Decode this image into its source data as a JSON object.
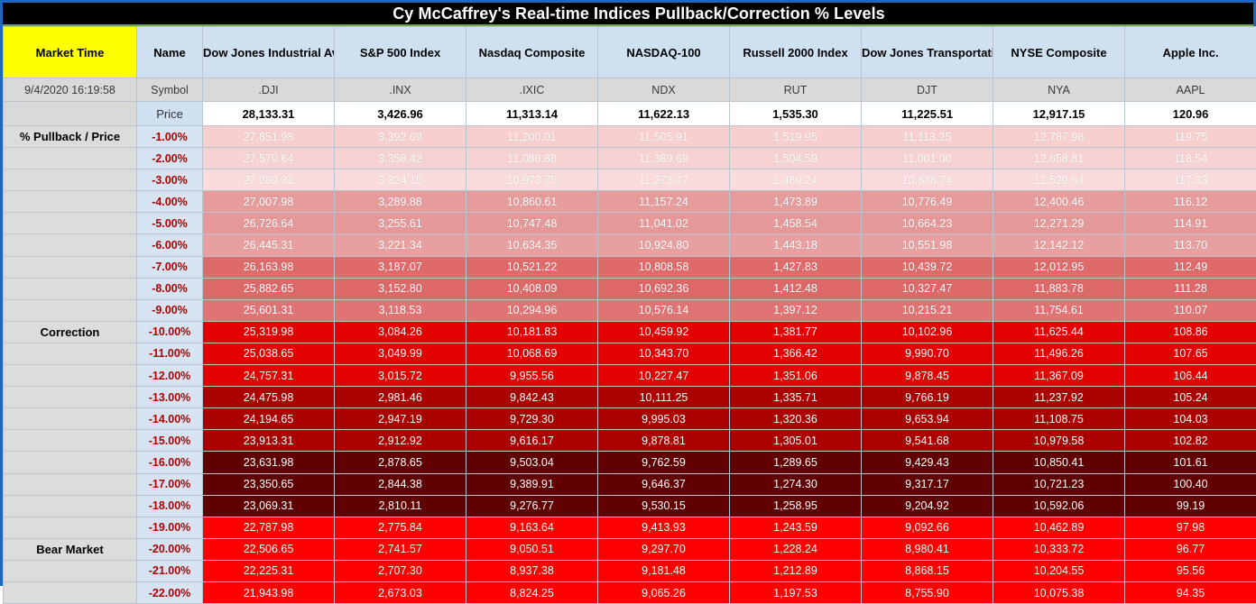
{
  "window": {
    "title": "Cy McCaffrey's Real-time Indices Pullback/Correction % Levels",
    "border_color": "#1f66c1",
    "title_bg": "#000000",
    "title_fg": "#ffffff",
    "accent_green": "#6ea64a"
  },
  "header": {
    "market_time_label": "Market Time",
    "name_label": "Name",
    "market_time_bg": "#ffff00",
    "header_bg": "#cfe0f0",
    "columns": [
      "Dow Jones Industrial Average",
      "S&P 500 Index",
      "Nasdaq Composite",
      "NASDAQ-100",
      "Russell 2000 Index",
      "Dow Jones Transportation Average",
      "NYSE Composite",
      "Apple Inc."
    ]
  },
  "symbol_row": {
    "timestamp": "9/4/2020 16:19:58",
    "row_label": "Symbol",
    "symbols": [
      ".DJI",
      ".INX",
      ".IXIC",
      "NDX",
      "RUT",
      "DJT",
      "NYA",
      "AAPL"
    ]
  },
  "price_row": {
    "row_label": "Price",
    "prices": [
      "28,133.31",
      "3,426.96",
      "11,313.14",
      "11,622.13",
      "1,535.30",
      "11,225.51",
      "12,917.15",
      "120.96"
    ]
  },
  "section_labels": {
    "pullback": "% Pullback / Price",
    "correction": "Correction",
    "bear_market": "Bear Market"
  },
  "rows": [
    {
      "label": "% Pullback / Price",
      "pct": "-1.00%",
      "band": "band1 b1a",
      "values": [
        "27,851.98",
        "3,392.69",
        "11,200.01",
        "11,505.91",
        "1,519.95",
        "11,113.25",
        "12,787.98",
        "119.75"
      ]
    },
    {
      "label": "",
      "pct": "-2.00%",
      "band": "band1 b1b",
      "values": [
        "27,570.64",
        "3,358.42",
        "11,086.88",
        "11,389.69",
        "1,504.59",
        "11,001.00",
        "12,658.81",
        "118.54"
      ]
    },
    {
      "label": "",
      "pct": "-3.00%",
      "band": "band1 b1c",
      "values": [
        "27,289.31",
        "3,324.15",
        "10,973.75",
        "11,273.47",
        "1,489.24",
        "10,888.74",
        "12,529.64",
        "117.33"
      ]
    },
    {
      "label": "",
      "pct": "-4.00%",
      "band": "band2 b2a",
      "values": [
        "27,007.98",
        "3,289.88",
        "10,860.61",
        "11,157.24",
        "1,473.89",
        "10,776.49",
        "12,400.46",
        "116.12"
      ]
    },
    {
      "label": "",
      "pct": "-5.00%",
      "band": "band2 b2b",
      "values": [
        "26,726.64",
        "3,255.61",
        "10,747.48",
        "11,041.02",
        "1,458.54",
        "10,664.23",
        "12,271.29",
        "114.91"
      ]
    },
    {
      "label": "",
      "pct": "-6.00%",
      "band": "band2 b2c",
      "values": [
        "26,445.31",
        "3,221.34",
        "10,634.35",
        "10,924.80",
        "1,443.18",
        "10,551.98",
        "12,142.12",
        "113.70"
      ]
    },
    {
      "label": "",
      "pct": "-7.00%",
      "band": "band3 b3a",
      "values": [
        "26,163.98",
        "3,187.07",
        "10,521.22",
        "10,808.58",
        "1,427.83",
        "10,439.72",
        "12,012.95",
        "112.49"
      ]
    },
    {
      "label": "",
      "pct": "-8.00%",
      "band": "band3 b3b",
      "values": [
        "25,882.65",
        "3,152.80",
        "10,408.09",
        "10,692.36",
        "1,412.48",
        "10,327.47",
        "11,883.78",
        "111.28"
      ]
    },
    {
      "label": "",
      "pct": "-9.00%",
      "band": "band3 b3c",
      "values": [
        "25,601.31",
        "3,118.53",
        "10,294.96",
        "10,576.14",
        "1,397.12",
        "10,215.21",
        "11,754.61",
        "110.07"
      ]
    },
    {
      "label": "Correction",
      "pct": "-10.00%",
      "band": "band4",
      "values": [
        "25,319.98",
        "3,084.26",
        "10,181.83",
        "10,459.92",
        "1,381.77",
        "10,102.96",
        "11,625.44",
        "108.86"
      ]
    },
    {
      "label": "",
      "pct": "-11.00%",
      "band": "band4",
      "values": [
        "25,038.65",
        "3,049.99",
        "10,068.69",
        "10,343.70",
        "1,366.42",
        "9,990.70",
        "11,496.26",
        "107.65"
      ]
    },
    {
      "label": "",
      "pct": "-12.00%",
      "band": "band4",
      "values": [
        "24,757.31",
        "3,015.72",
        "9,955.56",
        "10,227.47",
        "1,351.06",
        "9,878.45",
        "11,367.09",
        "106.44"
      ]
    },
    {
      "label": "",
      "pct": "-13.00%",
      "band": "band5",
      "values": [
        "24,475.98",
        "2,981.46",
        "9,842.43",
        "10,111.25",
        "1,335.71",
        "9,766.19",
        "11,237.92",
        "105.24"
      ]
    },
    {
      "label": "",
      "pct": "-14.00%",
      "band": "band5",
      "values": [
        "24,194.65",
        "2,947.19",
        "9,729.30",
        "9,995.03",
        "1,320.36",
        "9,653.94",
        "11,108.75",
        "104.03"
      ]
    },
    {
      "label": "",
      "pct": "-15.00%",
      "band": "band5",
      "values": [
        "23,913.31",
        "2,912.92",
        "9,616.17",
        "9,878.81",
        "1,305.01",
        "9,541.68",
        "10,979.58",
        "102.82"
      ]
    },
    {
      "label": "",
      "pct": "-16.00%",
      "band": "band6",
      "values": [
        "23,631.98",
        "2,878.65",
        "9,503.04",
        "9,762.59",
        "1,289.65",
        "9,429.43",
        "10,850.41",
        "101.61"
      ]
    },
    {
      "label": "",
      "pct": "-17.00%",
      "band": "band6",
      "values": [
        "23,350.65",
        "2,844.38",
        "9,389.91",
        "9,646.37",
        "1,274.30",
        "9,317.17",
        "10,721.23",
        "100.40"
      ]
    },
    {
      "label": "",
      "pct": "-18.00%",
      "band": "band6",
      "values": [
        "23,069.31",
        "2,810.11",
        "9,276.77",
        "9,530.15",
        "1,258.95",
        "9,204.92",
        "10,592.06",
        "99.19"
      ]
    },
    {
      "label": "",
      "pct": "-19.00%",
      "band": "band7",
      "values": [
        "22,787.98",
        "2,775.84",
        "9,163.64",
        "9,413.93",
        "1,243.59",
        "9,092.66",
        "10,462.89",
        "97.98"
      ]
    },
    {
      "label": "Bear Market",
      "pct": "-20.00%",
      "band": "band7",
      "values": [
        "22,506.65",
        "2,741.57",
        "9,050.51",
        "9,297.70",
        "1,228.24",
        "8,980.41",
        "10,333.72",
        "96.77"
      ]
    },
    {
      "label": "",
      "pct": "-21.00%",
      "band": "band7",
      "values": [
        "22,225.31",
        "2,707.30",
        "8,937.38",
        "9,181.48",
        "1,212.89",
        "8,868.15",
        "10,204.55",
        "95.56"
      ]
    },
    {
      "label": "",
      "pct": "-22.00%",
      "band": "band7",
      "values": [
        "21,943.98",
        "2,673.03",
        "8,824.25",
        "9,065.26",
        "1,197.53",
        "8,755.90",
        "10,075.38",
        "94.35"
      ]
    }
  ]
}
